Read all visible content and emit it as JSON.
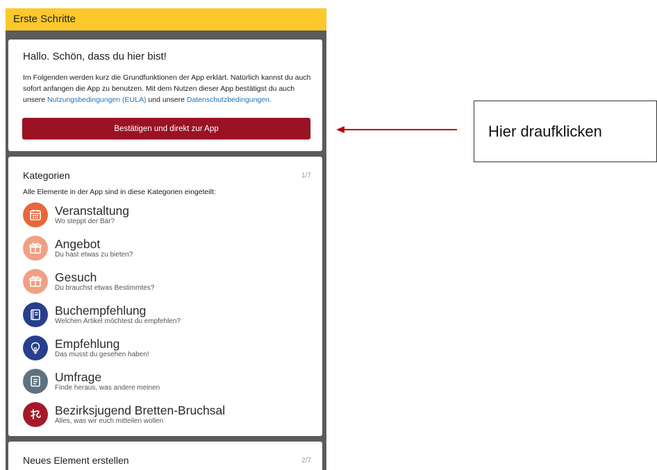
{
  "header": {
    "title": "Erste Schritte"
  },
  "welcome": {
    "title": "Hallo. Schön, dass du hier bist!",
    "text_1": "Im Folgenden werden kurz die Grundfunktionen der App erklärt. Natürlich kannst du auch sofort anfangen die App zu benutzen. Mit dem Nutzen dieser App bestätigst du auch unsere ",
    "link_eula": "Nutzungsbedingungen (EULA)",
    "text_2": " und unsere ",
    "link_privacy": "Datenschutzbedingungen.",
    "confirm_button": "Bestätigen und direkt zur App"
  },
  "categories_section": {
    "title": "Kategorien",
    "count": "1/7",
    "subtitle": "Alle Elemente in der App sind in diese Kategorien eingeteilt:",
    "items": [
      {
        "name": "Veranstaltung",
        "desc": "Wo steppt der Bär?",
        "icon": "calendar-icon",
        "color": "#e8673a"
      },
      {
        "name": "Angebot",
        "desc": "Du hast etwas zu bieten?",
        "icon": "gift-icon",
        "color": "#f0a083"
      },
      {
        "name": "Gesuch",
        "desc": "Du brauchst etwas Bestimmtes?",
        "icon": "gift-icon",
        "color": "#f0a083"
      },
      {
        "name": "Buchempfehlung",
        "desc": "Welchen Artikel möchtest du empfehlen?",
        "icon": "book-icon",
        "color": "#273f8c"
      },
      {
        "name": "Empfehlung",
        "desc": "Das musst du gesehen haben!",
        "icon": "lightbulb-icon",
        "color": "#273f8c"
      },
      {
        "name": "Umfrage",
        "desc": "Finde heraus, was andere meinen",
        "icon": "survey-icon",
        "color": "#5d7280"
      },
      {
        "name": "Bezirksjugend Bretten-Bruchsal",
        "desc": "Alles, was wir euch mitteilen wollen",
        "icon": "logo-icon",
        "color": "#a51a2a"
      }
    ]
  },
  "next_section": {
    "title": "Neues Element erstellen",
    "count": "2/7"
  },
  "callout": {
    "text": "Hier draufklicken"
  },
  "colors": {
    "header": "#fcc82c",
    "button": "#9a1224",
    "link": "#1e73b8",
    "arrow": "#c00000"
  }
}
